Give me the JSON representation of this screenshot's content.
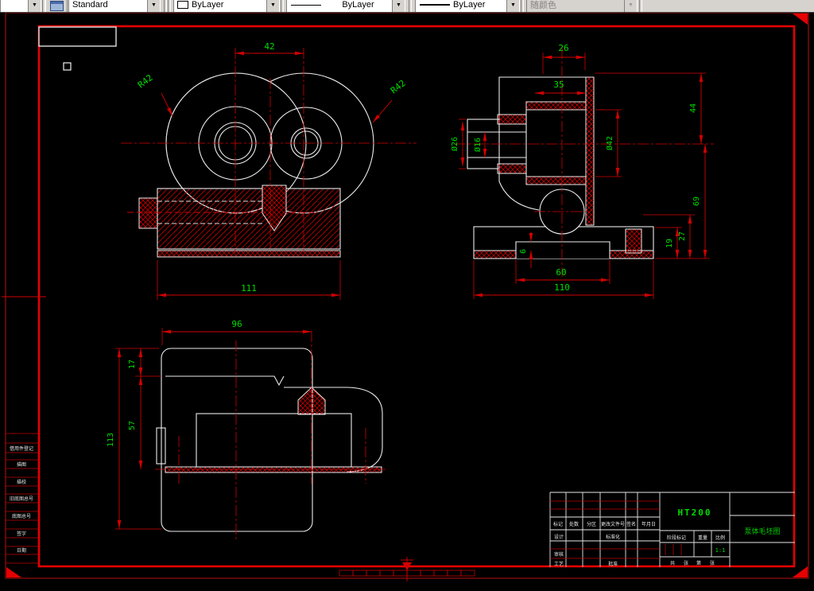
{
  "toolbar": {
    "layer_combo": {
      "value": ""
    },
    "style_combo": {
      "value": "Standard"
    },
    "color_combo": {
      "value": "ByLayer"
    },
    "linetype_combo": {
      "value": "ByLayer"
    },
    "lineweight_combo": {
      "value": "ByLayer"
    },
    "plotstyle_combo": {
      "value": "随颜色"
    },
    "dropdown_glyph": "▼"
  },
  "colors": {
    "outline": "#ececec",
    "dimension_red": "#d40000",
    "dimension_text_green": "#00dd00",
    "frame_red": "#e60000",
    "toolbar_gray": "#d6d3ce"
  },
  "drawing": {
    "front_view": {
      "dims": {
        "top_width": "42",
        "left_radius": "R42",
        "right_radius": "R42",
        "base_width": "111"
      }
    },
    "side_view": {
      "dims": {
        "top_width": "26",
        "bore_width": "35",
        "flange_dia": "Ø26",
        "hole_dia": "Ø16",
        "bore_dia": "Ø42",
        "upper_height": "44",
        "total_height": "69",
        "step_height": "27",
        "pad_height": "19",
        "recess_depth": "6",
        "recess_width": "60",
        "base_width": "110"
      }
    },
    "plan_view": {
      "dims": {
        "top_width": "96",
        "edge_offset": "17",
        "body_depth": "57",
        "total_depth": "113"
      }
    }
  },
  "title_block": {
    "material": "HT200",
    "drawing_title": "泵体毛坯图",
    "scale_value": "1:1",
    "headers": {
      "mark": "标记",
      "count": "处数",
      "zone": "分区",
      "change_file": "更改文件号",
      "signature": "签名",
      "date": "年月日"
    },
    "rows": {
      "design": "设计",
      "standardize": "标准化",
      "review": "审核",
      "process": "工艺",
      "approve": "批准"
    },
    "stage_label": "阶段标记",
    "weight_label": "重量",
    "scale_label": "比例",
    "sheet_total": "共",
    "sheet_unit1": "张",
    "sheet_no": "第",
    "sheet_unit2": "张"
  },
  "margin_strip": {
    "labels": [
      "借用件登记",
      "描图",
      "描校",
      "旧底图总号",
      "底图总号",
      "签字",
      "日期"
    ]
  }
}
